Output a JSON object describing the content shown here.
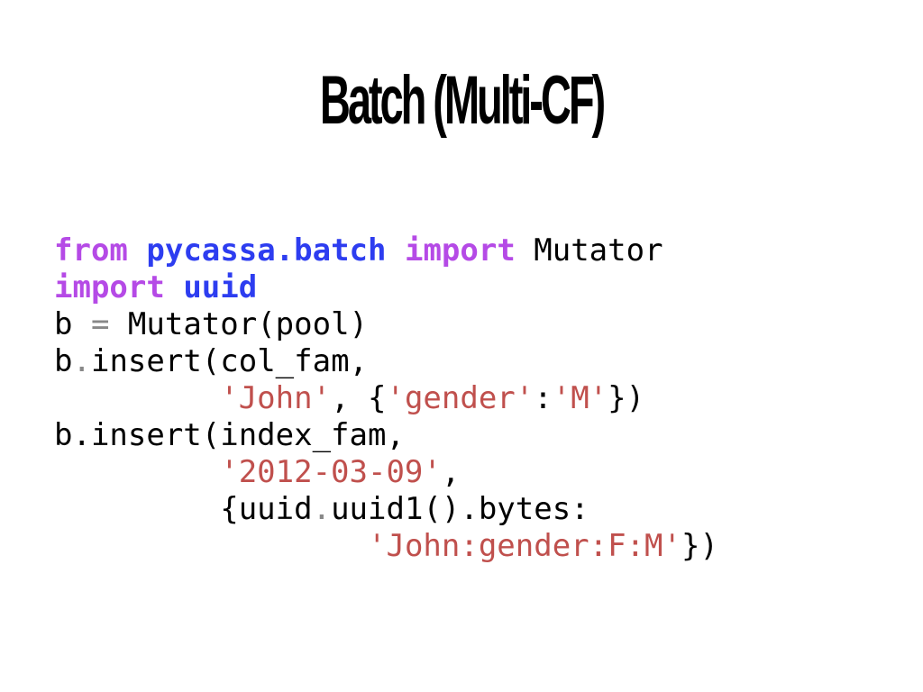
{
  "slide": {
    "title": "Batch (Multi-CF)"
  },
  "colors": {
    "keyword": "#b54ae6",
    "module": "#2d3df0",
    "string": "#c0504d",
    "operator": "#888888",
    "text": "#000000"
  },
  "code": {
    "lines": [
      [
        {
          "t": "from",
          "k": "kw"
        },
        {
          "t": " ",
          "k": "plain"
        },
        {
          "t": "pycassa.batch",
          "k": "mod"
        },
        {
          "t": " ",
          "k": "plain"
        },
        {
          "t": "import",
          "k": "kw"
        },
        {
          "t": " Mutator",
          "k": "plain"
        }
      ],
      [
        {
          "t": "import",
          "k": "kw"
        },
        {
          "t": " ",
          "k": "plain"
        },
        {
          "t": "uuid",
          "k": "mod"
        }
      ],
      [
        {
          "t": "b ",
          "k": "plain"
        },
        {
          "t": "=",
          "k": "op"
        },
        {
          "t": " Mutator(pool)",
          "k": "plain"
        }
      ],
      [
        {
          "t": "b",
          "k": "plain"
        },
        {
          "t": ".",
          "k": "op"
        },
        {
          "t": "insert(col_fam,",
          "k": "plain"
        }
      ],
      [
        {
          "t": "         ",
          "k": "plain"
        },
        {
          "t": "'John'",
          "k": "str"
        },
        {
          "t": ", {",
          "k": "plain"
        },
        {
          "t": "'gender'",
          "k": "str"
        },
        {
          "t": ":",
          "k": "plain"
        },
        {
          "t": "'M'",
          "k": "str"
        },
        {
          "t": "})",
          "k": "plain"
        }
      ],
      [
        {
          "t": "b.insert(index_fam,",
          "k": "plain"
        }
      ],
      [
        {
          "t": "         ",
          "k": "plain"
        },
        {
          "t": "'2012-03-09'",
          "k": "str"
        },
        {
          "t": ",",
          "k": "plain"
        }
      ],
      [
        {
          "t": "         {uuid",
          "k": "plain"
        },
        {
          "t": ".",
          "k": "op"
        },
        {
          "t": "uuid1().bytes:",
          "k": "plain"
        }
      ],
      [
        {
          "t": "                 ",
          "k": "plain"
        },
        {
          "t": "'John:gender:F:M'",
          "k": "str"
        },
        {
          "t": "})",
          "k": "plain"
        }
      ]
    ]
  }
}
